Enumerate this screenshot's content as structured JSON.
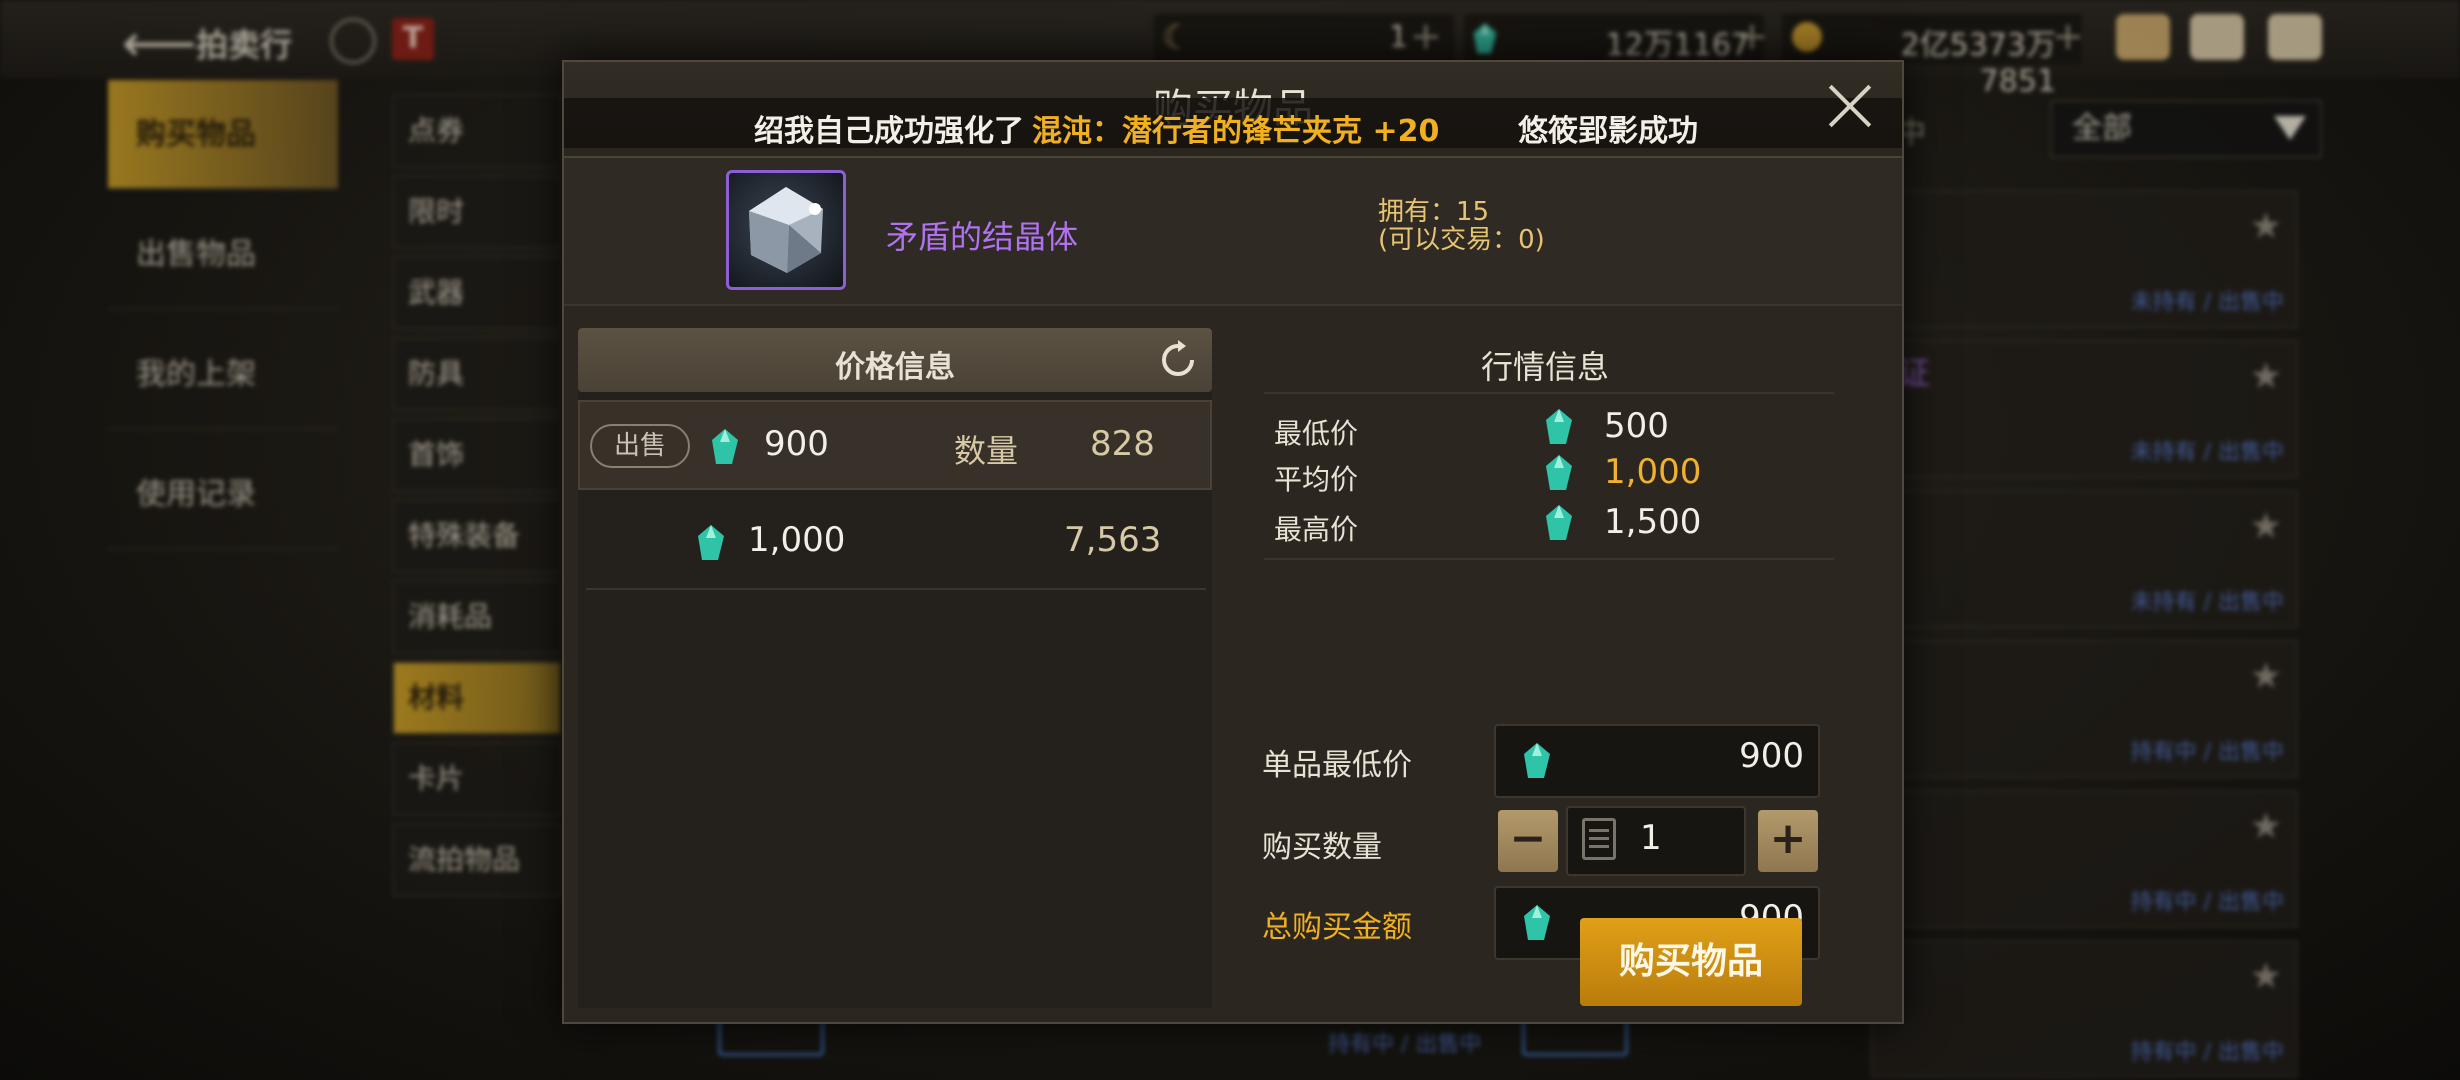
{
  "background": {
    "title": "拍卖行",
    "currencies": [
      "1",
      "12万1167",
      "2亿5373万7851"
    ],
    "nav": [
      "购买物品",
      "出售物品",
      "我的上架",
      "使用记录"
    ],
    "categories": [
      "点券",
      "限时",
      "武器",
      "防具",
      "首饰",
      "特殊装备",
      "消耗品",
      "材料",
      "卡片",
      "流拍物品"
    ],
    "filter": "全部",
    "trade_tab": "中",
    "purple_fragment": "行证",
    "card_status": [
      "未持有 / 出售中",
      "未持有 / 出售中",
      "未持有 / 出售中",
      "持有中 / 出售中",
      "持有中 / 出售中",
      "持有中 / 出售中"
    ],
    "bottom_status": [
      "持有中 / 出售中",
      "持有中 / 出售中"
    ]
  },
  "modal": {
    "title": "购买物品",
    "notice": {
      "prefix": "绍我自己成功强化了",
      "item": "混沌：潜行者的锋芒夹克 +20",
      "suffix": "悠筱郢影成功"
    },
    "item": {
      "name": "矛盾的结晶体",
      "owned": "拥有：15",
      "tradeable": "(可以交易：0)"
    },
    "price_info": {
      "header": "价格信息",
      "sell_label": "出售",
      "qty_label": "数量",
      "rows": [
        {
          "price": "900",
          "qty": "828"
        },
        {
          "price": "1,000",
          "qty": "7,563"
        }
      ]
    },
    "market": {
      "header": "行情信息",
      "min_label": "最低价",
      "min": "500",
      "avg_label": "平均价",
      "avg": "1,000",
      "max_label": "最高价",
      "max": "1,500"
    },
    "purchase": {
      "unit_label": "单品最低价",
      "unit_value": "900",
      "qty_label": "购买数量",
      "qty_value": "1",
      "total_label": "总购买金额",
      "total_value": "900",
      "buy_button": "购买物品"
    }
  },
  "colors": {
    "accent_gold": "#f0b020",
    "item_purple": "#b072f0",
    "buy_button": "#d99414"
  }
}
